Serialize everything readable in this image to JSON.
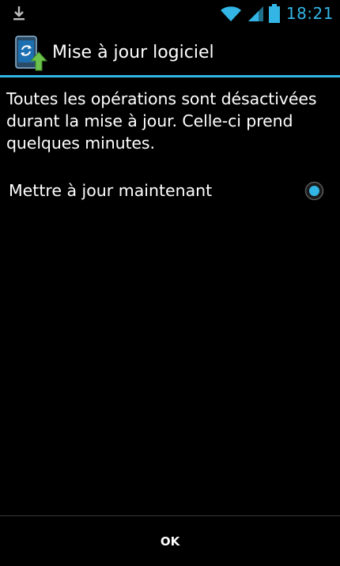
{
  "status_bar": {
    "time": "18:21",
    "accent_color": "#33b5e5",
    "icons": [
      "download-icon",
      "wifi-icon",
      "signal-icon",
      "battery-icon"
    ]
  },
  "dialog": {
    "title": "Mise à jour logiciel",
    "app_icon": "system-update-icon",
    "message": "Toutes les opérations sont désactivées durant la mise à jour. Celle-ci prend quelques minutes.",
    "options": [
      {
        "label": "Mettre à jour maintenant",
        "selected": true
      }
    ],
    "ok_label": "OK"
  },
  "colors": {
    "background": "#000000",
    "accent": "#33b5e5",
    "text": "#ffffff"
  }
}
